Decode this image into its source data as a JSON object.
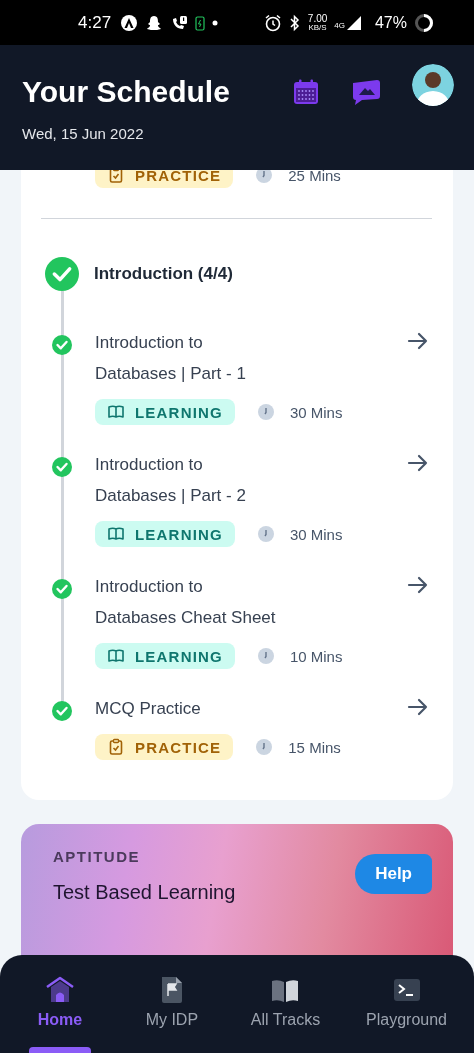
{
  "status_bar": {
    "time": "4:27",
    "net_speed": "7.00",
    "net_unit": "KB/S",
    "network": "4G",
    "battery": "47%"
  },
  "header": {
    "title": "Your Schedule",
    "date": "Wed, 15 Jun 2022"
  },
  "partial_item": {
    "tag": {
      "kind": "practice",
      "label": "PRACTICE"
    },
    "duration": "25 Mins"
  },
  "section": {
    "title": "Introduction (4/4)",
    "completed": true,
    "items": [
      {
        "title": "Introduction to Databases | Part - 1",
        "completed": true,
        "tag": {
          "kind": "learning",
          "label": "LEARNING"
        },
        "duration": "30 Mins"
      },
      {
        "title": "Introduction to Databases | Part - 2",
        "completed": true,
        "tag": {
          "kind": "learning",
          "label": "LEARNING"
        },
        "duration": "30 Mins"
      },
      {
        "title": "Introduction to Databases Cheat Sheet",
        "completed": true,
        "tag": {
          "kind": "learning",
          "label": "LEARNING"
        },
        "duration": "10 Mins"
      },
      {
        "title": "MCQ Practice",
        "completed": true,
        "tag": {
          "kind": "practice",
          "label": "PRACTICE"
        },
        "duration": "15 Mins"
      }
    ]
  },
  "promo": {
    "category": "APTITUDE",
    "title": "Test Based Learning"
  },
  "help_button": "Help",
  "nav": [
    {
      "label": "Home",
      "kind": "home",
      "selected": true
    },
    {
      "label": "My IDP",
      "kind": "document",
      "selected": false
    },
    {
      "label": "All Tracks",
      "kind": "book",
      "selected": false
    },
    {
      "label": "Playground",
      "kind": "terminal",
      "selected": false
    }
  ]
}
